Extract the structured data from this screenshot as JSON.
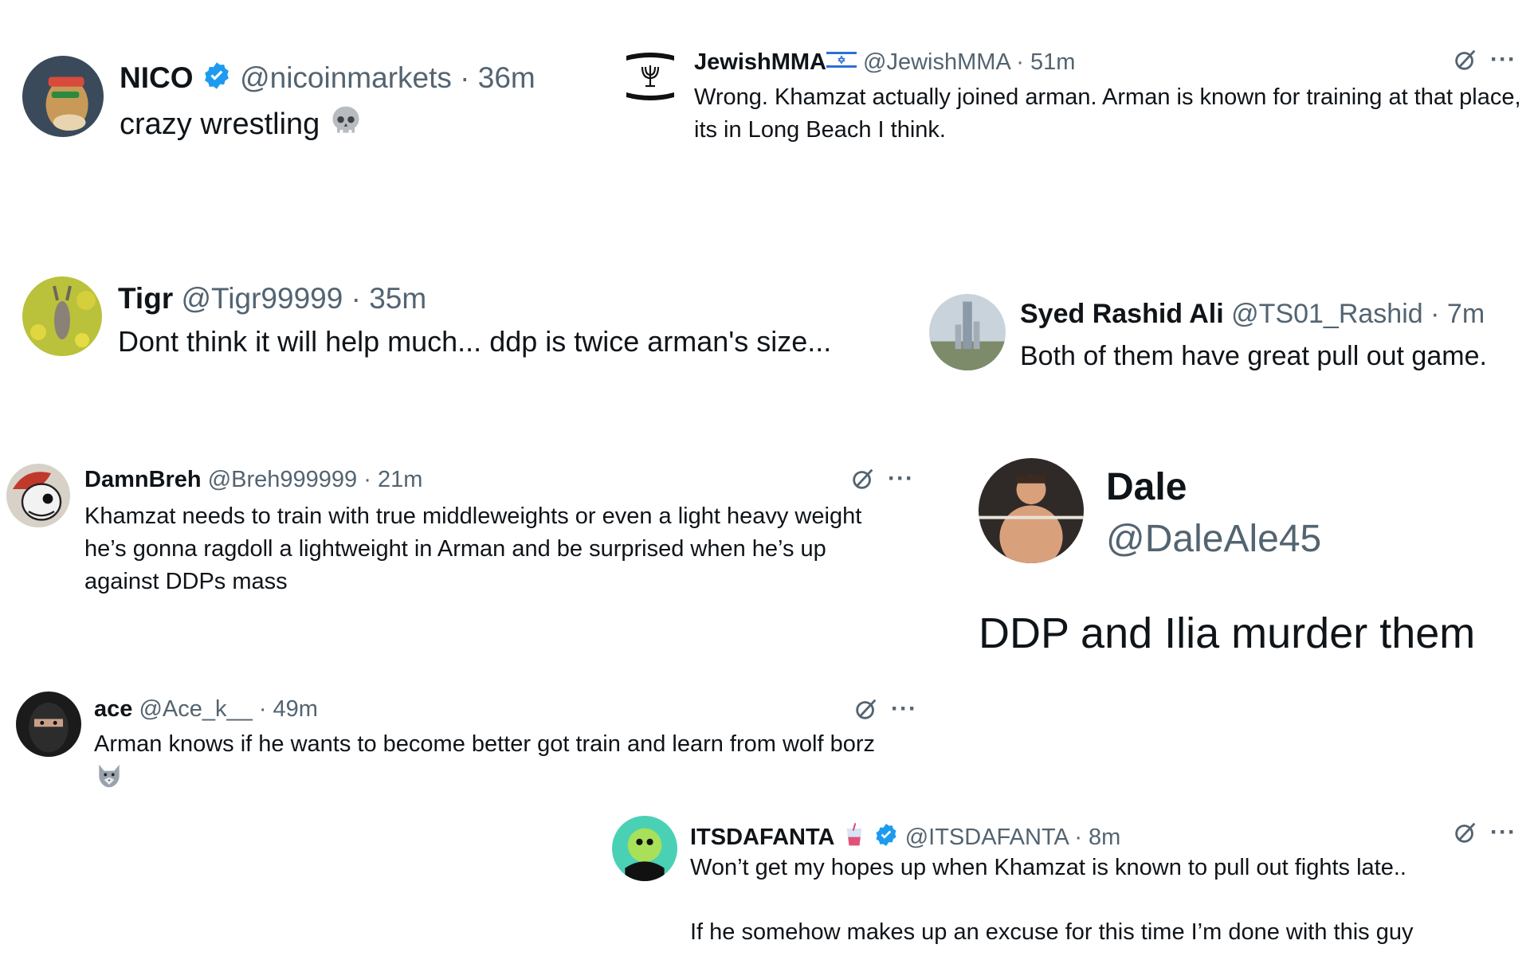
{
  "tweets": {
    "nico": {
      "name": "NICO",
      "handle": "@nicoinmarkets",
      "sep": "·",
      "time": "36m",
      "text": "crazy wrestling",
      "verified": true,
      "emoji": "skull"
    },
    "jewishmma": {
      "name": "JewishMMA",
      "handle": "@JewishMMA",
      "sep": "·",
      "time": "51m",
      "text": "Wrong. Khamzat actually joined arman. Arman is known for training at that place, its in Long Beach I think.",
      "flag": "israel-flag"
    },
    "tigr": {
      "name": "Tigr",
      "handle": "@Tigr99999",
      "sep": "·",
      "time": "35m",
      "text": "Dont think it will help much... ddp is twice arman's size..."
    },
    "syed": {
      "name": "Syed Rashid Ali",
      "handle": "@TS01_Rashid",
      "sep": "·",
      "time": "7m",
      "text": "Both of them have great pull out game."
    },
    "damnbreh": {
      "name": "DamnBreh",
      "handle": "@Breh999999",
      "sep": "·",
      "time": "21m",
      "text": "Khamzat needs to train with true middleweights or even a light heavy weight he’s gonna ragdoll a lightweight in Arman and be surprised when he’s up against DDPs mass"
    },
    "dale": {
      "name": "Dale",
      "handle": "@DaleAle45",
      "text": "DDP and Ilia murder them"
    },
    "ace": {
      "name": "ace",
      "handle": "@Ace_k__",
      "sep": "·",
      "time": "49m",
      "text": "Arman knows if he wants to become better got train and learn from wolf borz",
      "emoji": "wolf"
    },
    "itsdafanta": {
      "name": "ITSDAFANTA",
      "handle": "@ITSDAFANTA",
      "sep": "·",
      "time": "8m",
      "verified": true,
      "name_emoji": "soda-cup",
      "text_line1": "Won’t get my hopes up when Khamzat is known to pull out fights late..",
      "text_line2": "If he somehow makes up an excuse for this time I’m done with this guy"
    }
  },
  "icons": {
    "grok": "grok-icon",
    "more": "···"
  },
  "colors": {
    "text": "#0f1419",
    "secondary": "#536471",
    "verified": "#1d9bf0"
  }
}
